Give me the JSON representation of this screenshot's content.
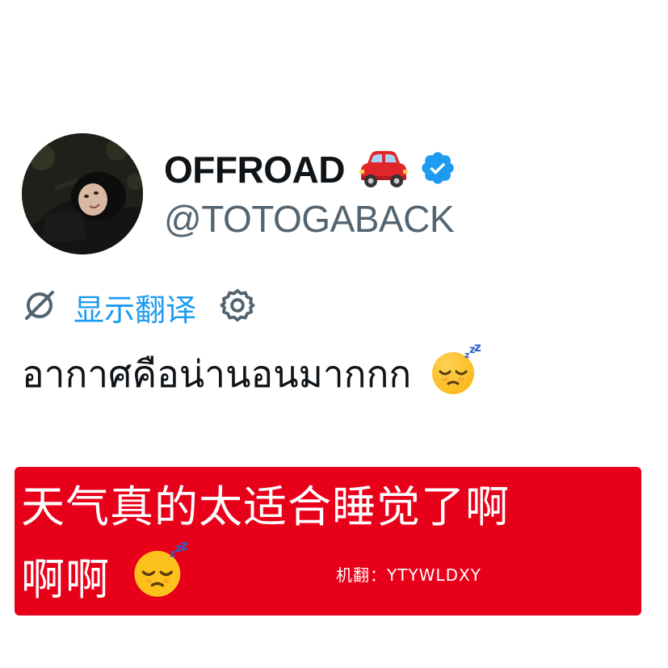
{
  "profile": {
    "display_name": "OFFROAD",
    "handle": "@TOTOGABACK",
    "car_emoji": "car-icon",
    "verified": "verified-badge-icon"
  },
  "translate": {
    "link_label": "显示翻译",
    "translate_icon": "translate-icon",
    "settings_icon": "gear-icon"
  },
  "tweet": {
    "text": "อากาศคือน่านอนมากกก",
    "emoji": "sleeping-face-icon"
  },
  "overlay": {
    "line1": "天气真的太适合睡觉了啊",
    "line2": "啊啊",
    "emoji": "sleeping-face-icon",
    "credit": "机翻：YTYWLDXY",
    "background": "#e8001a"
  },
  "colors": {
    "name": "#0f1419",
    "handle": "#536471",
    "link": "#1d9bf0",
    "verified": "#1d9bf0"
  }
}
